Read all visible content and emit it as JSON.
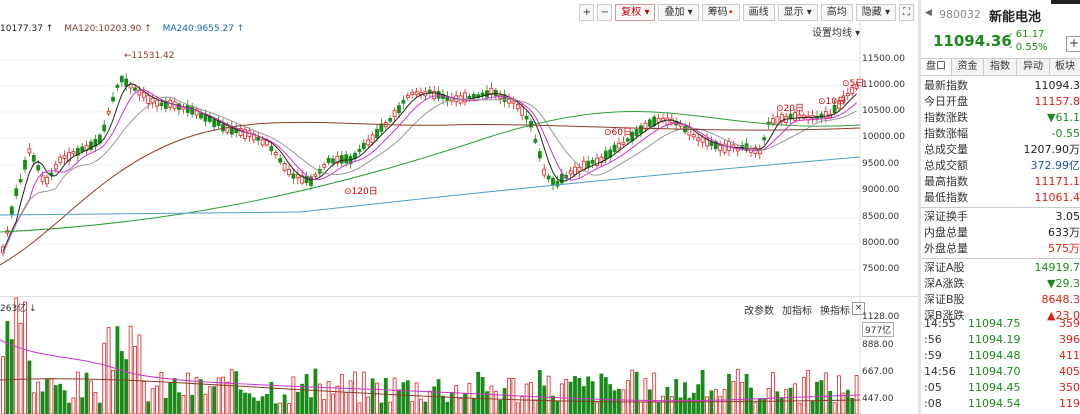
{
  "toolbar": {
    "plus": "+",
    "minus": "−",
    "fuquan": "复权",
    "diejia": "叠加",
    "chouma": "筹码",
    "huaxian": "画线",
    "xianshi": "显示",
    "gaojia": "高均",
    "yincang": "隐藏"
  },
  "ma_legend": {
    "ma_first": "10177.37 ↑",
    "ma120": "MA120:10203.90 ↑",
    "ma240": "MA240:9655.27 ↑"
  },
  "settings_link": "设置均线",
  "price_axis": [
    "11500.00",
    "11000.00",
    "10500.00",
    "10000.00",
    "9500.00",
    "9000.00",
    "8500.00",
    "8000.00",
    "7500.00"
  ],
  "annotations": {
    "high_label": "11531.42",
    "d120": "120日",
    "d60": "60日",
    "d20": "20日",
    "d10": "10日",
    "d5": "5日"
  },
  "volume": {
    "label": "263亿 ↓",
    "tools": [
      "改参数",
      "加指标",
      "换指标"
    ],
    "close": "×",
    "axis": [
      "1128.00",
      "977亿",
      "888.00",
      "667.00",
      "447.00"
    ]
  },
  "panel": {
    "code": "980032",
    "name": "新能电池",
    "price": "11094.36",
    "change": "- 61.17",
    "change_pct": "- 0.55%",
    "plus": "+",
    "tabs": [
      "盘口",
      "资金",
      "指数",
      "异动",
      "板块"
    ],
    "stats": [
      {
        "label": "最新指数",
        "value": "11094.3"
      },
      {
        "label": "今日开盘",
        "value": "11157.8"
      },
      {
        "label": "指数涨跌",
        "value": "▼61.1"
      },
      {
        "label": "指数涨幅",
        "value": "-0.55"
      },
      {
        "label": "总成交量",
        "value": "1207.90万"
      },
      {
        "label": "总成交额",
        "value": "372.99亿"
      },
      {
        "label": "最高指数",
        "value": "11171.1"
      },
      {
        "label": "最低指数",
        "value": "11061.4"
      }
    ],
    "stats2": [
      {
        "label": "深证换手",
        "value": "3.05"
      },
      {
        "label": "内盘总量",
        "value": "633万"
      },
      {
        "label": "外盘总量",
        "value": "575万"
      }
    ],
    "stats3": [
      {
        "label": "深证A股",
        "value": "14919.7"
      },
      {
        "label": "深A涨跌",
        "value": "▼29.3"
      },
      {
        "label": "深证B股",
        "value": "8648.3"
      },
      {
        "label": "深B涨跌",
        "value": "▲23.0"
      }
    ],
    "ticks": [
      {
        "time": "14:55",
        "price": "11094.75",
        "vol": "359"
      },
      {
        "time": ":56",
        "price": "11094.19",
        "vol": "396"
      },
      {
        "time": ":59",
        "price": "11094.48",
        "vol": "411"
      },
      {
        "time": "14:56",
        "price": "11094.70",
        "vol": "405"
      },
      {
        "time": ":05",
        "price": "11094.45",
        "vol": "350"
      },
      {
        "time": ":08",
        "price": "11094.54",
        "vol": "119"
      }
    ]
  },
  "colors": {
    "up": "#dd2222",
    "down": "#1a8a1a",
    "ma5": "#222222",
    "ma10": "#cc33cc",
    "ma20": "#999999",
    "ma60": "#2e9e3a",
    "ma120": "#8a3d2a",
    "ma240": "#4aa0c8"
  }
}
